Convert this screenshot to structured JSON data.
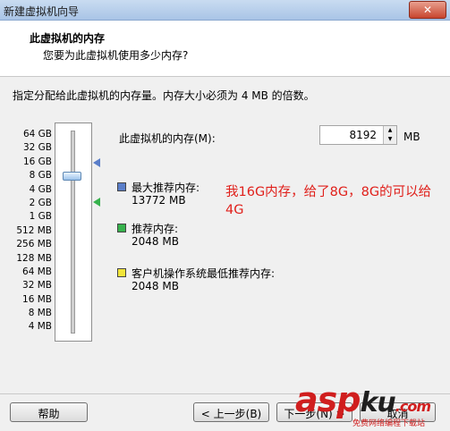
{
  "window": {
    "title": "新建虚拟机向导",
    "close_label": "✕"
  },
  "header": {
    "title": "此虚拟机的内存",
    "subtitle": "您要为此虚拟机使用多少内存?"
  },
  "instruction": "指定分配给此虚拟机的内存量。内存大小必须为 4 MB 的倍数。",
  "scale_labels": [
    "64 GB",
    "32 GB",
    "16 GB",
    "8 GB",
    "4 GB",
    "2 GB",
    "1 GB",
    "512 MB",
    "256 MB",
    "128 MB",
    "64 MB",
    "32 MB",
    "16 MB",
    "8 MB",
    "4 MB"
  ],
  "memory": {
    "label": "此虚拟机的内存(M):",
    "value": "8192",
    "unit": "MB"
  },
  "legend": {
    "max": {
      "label": "最大推荐内存:",
      "value": "13772 MB",
      "color": "#5a7ec9"
    },
    "recommended": {
      "label": "推荐内存:",
      "value": "2048 MB",
      "color": "#37b24d"
    },
    "min": {
      "label": "客户机操作系统最低推荐内存:",
      "value": "2048 MB",
      "color": "#f2e53a"
    }
  },
  "annotation": "我16G内存，给了8G，8G的可以给4G",
  "buttons": {
    "help": "帮助",
    "back": "< 上一步(B)",
    "next": "下一步(N) >",
    "cancel": "取消"
  },
  "watermark": {
    "brand_a": "asp",
    "brand_b": "ku",
    "suffix": ".com",
    "sub": "免费网络编程下载站"
  }
}
